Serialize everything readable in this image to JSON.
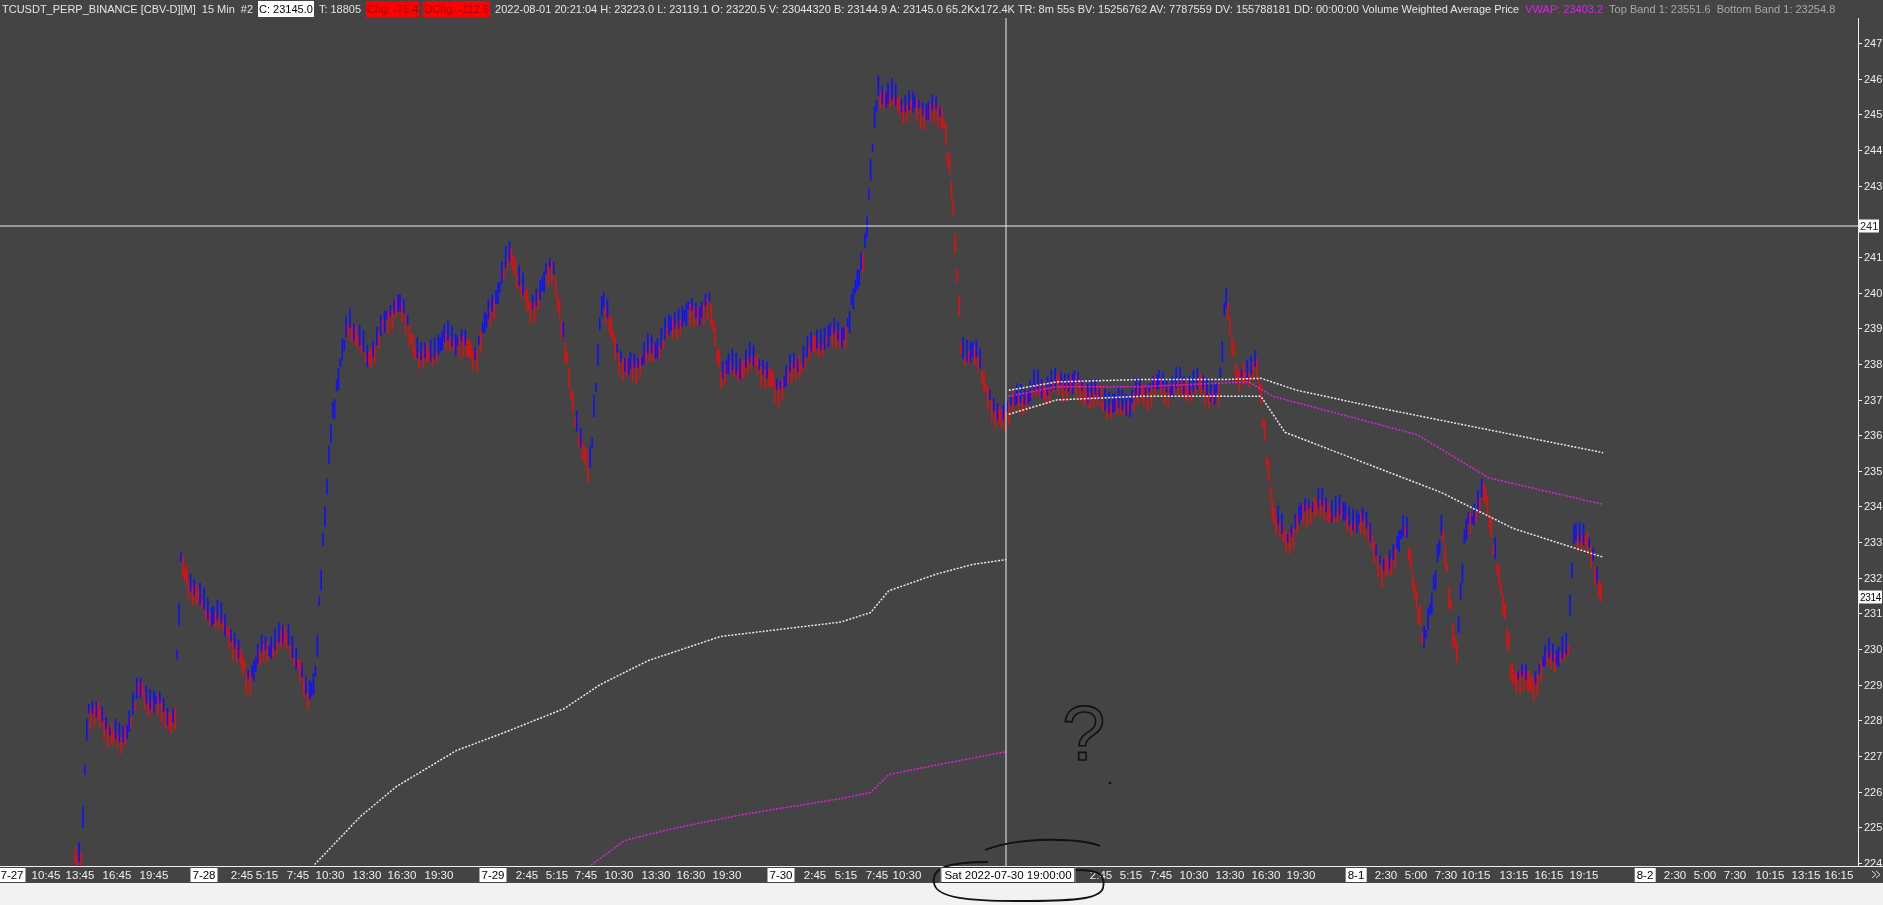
{
  "header": [
    {
      "kind": "plain",
      "text": "TCUSDT_PERP_BINANCE [CBV-D][M]"
    },
    {
      "kind": "plain",
      "text": "15 Min"
    },
    {
      "kind": "plain",
      "text": "#2"
    },
    {
      "kind": "boxed",
      "text": "C: 23145.0"
    },
    {
      "kind": "plain",
      "text": "T: 18805"
    },
    {
      "kind": "alert",
      "text": "Chg: -75.4"
    },
    {
      "kind": "alert",
      "text": "DChg: -112.6"
    },
    {
      "kind": "plain",
      "text": "2022-08-01 20:21:04 H: 23223.0 L: 23119.1 O: 23220.5 V: 23044320 B: 23144.9 A: 23145.0 65.2Kx172.4K TR: 8m 55s BV: 15256762 AV: 7787559 DV: 155788181 DD: 00:00:00 Volume Weighted Average Price"
    },
    {
      "kind": "vwap",
      "text": "VWAP: 23403.2"
    },
    {
      "kind": "band",
      "text": "Top Band 1: 23551.6"
    },
    {
      "kind": "band",
      "text": "Bottom Band 1: 23254.8"
    }
  ],
  "price_axis": [
    {
      "kind": "tick",
      "text": "247"
    },
    {
      "kind": "tick",
      "text": "246"
    },
    {
      "kind": "tick",
      "text": "245"
    },
    {
      "kind": "tick",
      "text": "244"
    },
    {
      "kind": "tick",
      "text": "243"
    },
    {
      "kind": "crosshair",
      "text": "241"
    },
    {
      "kind": "tick",
      "text": "241"
    },
    {
      "kind": "tick",
      "text": "240"
    },
    {
      "kind": "tick",
      "text": "239"
    },
    {
      "kind": "tick",
      "text": "238"
    },
    {
      "kind": "tick",
      "text": "237"
    },
    {
      "kind": "tick",
      "text": "236"
    },
    {
      "kind": "tick",
      "text": "235"
    },
    {
      "kind": "tick",
      "text": "234"
    },
    {
      "kind": "tick",
      "text": "233"
    },
    {
      "kind": "tick",
      "text": "232"
    },
    {
      "kind": "last",
      "text": "2314"
    },
    {
      "kind": "tick",
      "text": "231"
    },
    {
      "kind": "tick",
      "text": "230"
    },
    {
      "kind": "tick",
      "text": "229"
    },
    {
      "kind": "tick",
      "text": "228"
    },
    {
      "kind": "tick",
      "text": "227"
    },
    {
      "kind": "tick",
      "text": "226"
    },
    {
      "kind": "tick",
      "text": "225"
    },
    {
      "kind": "tick",
      "text": "224"
    }
  ],
  "time_axis": [
    {
      "kind": "date",
      "text": "7-27"
    },
    {
      "kind": "time",
      "text": "10:45"
    },
    {
      "kind": "time",
      "text": "13:45"
    },
    {
      "kind": "time",
      "text": "16:45"
    },
    {
      "kind": "time",
      "text": "19:45"
    },
    {
      "kind": "date",
      "text": "7-28"
    },
    {
      "kind": "time",
      "text": "2:45"
    },
    {
      "kind": "time",
      "text": "5:15"
    },
    {
      "kind": "time",
      "text": "7:45"
    },
    {
      "kind": "time",
      "text": "10:30"
    },
    {
      "kind": "time",
      "text": "13:30"
    },
    {
      "kind": "time",
      "text": "16:30"
    },
    {
      "kind": "time",
      "text": "19:30"
    },
    {
      "kind": "date",
      "text": "7-29"
    },
    {
      "kind": "time",
      "text": "2:45"
    },
    {
      "kind": "time",
      "text": "5:15"
    },
    {
      "kind": "time",
      "text": "7:45"
    },
    {
      "kind": "time",
      "text": "10:30"
    },
    {
      "kind": "time",
      "text": "13:30"
    },
    {
      "kind": "time",
      "text": "16:30"
    },
    {
      "kind": "time",
      "text": "19:30"
    },
    {
      "kind": "date",
      "text": "7-30"
    },
    {
      "kind": "time",
      "text": "2:45"
    },
    {
      "kind": "time",
      "text": "5:15"
    },
    {
      "kind": "time",
      "text": "7:45"
    },
    {
      "kind": "time",
      "text": "10:30"
    },
    {
      "kind": "cursor",
      "text": "Sat 2022-07-30  19:00:00"
    },
    {
      "kind": "time",
      "text": "2:45"
    },
    {
      "kind": "time",
      "text": "5:15"
    },
    {
      "kind": "time",
      "text": "7:45"
    },
    {
      "kind": "time",
      "text": "10:30"
    },
    {
      "kind": "time",
      "text": "13:30"
    },
    {
      "kind": "time",
      "text": "16:30"
    },
    {
      "kind": "time",
      "text": "19:30"
    },
    {
      "kind": "date",
      "text": "8-1"
    },
    {
      "kind": "time",
      "text": "2:30"
    },
    {
      "kind": "time",
      "text": "5:00"
    },
    {
      "kind": "time",
      "text": "7:30"
    },
    {
      "kind": "time",
      "text": "10:15"
    },
    {
      "kind": "time",
      "text": "13:15"
    },
    {
      "kind": "time",
      "text": "16:15"
    },
    {
      "kind": "time",
      "text": "19:15"
    },
    {
      "kind": "date",
      "text": "8-2"
    },
    {
      "kind": "time",
      "text": "2:30"
    },
    {
      "kind": "time",
      "text": "5:00"
    },
    {
      "kind": "time",
      "text": "7:30"
    },
    {
      "kind": "time",
      "text": "10:15"
    },
    {
      "kind": "time",
      "text": "13:15"
    },
    {
      "kind": "time",
      "text": "16:15"
    }
  ],
  "annotation": {
    "text": "?"
  }
}
